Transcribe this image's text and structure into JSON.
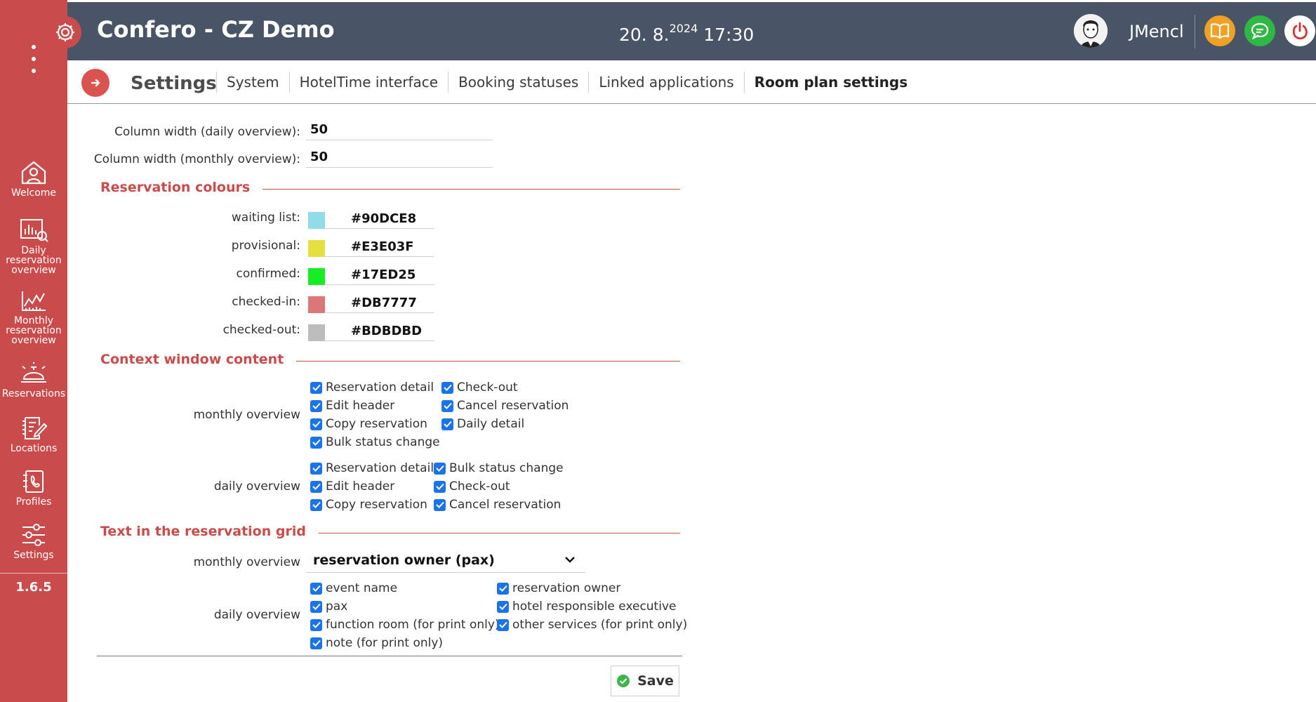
{
  "topbar": {
    "title": "Confero - CZ Demo",
    "date": "20. 8.",
    "year": "2024",
    "time": "17:30",
    "username": "JMencl"
  },
  "sidebar": {
    "items": [
      {
        "label": "Welcome",
        "icon": "house-user-icon"
      },
      {
        "label": "Daily reservation overview",
        "icon": "daily-chart-search-icon"
      },
      {
        "label": "Monthly reservation overview",
        "icon": "monthly-line-chart-icon"
      },
      {
        "label": "Reservations",
        "icon": "service-bell-icon"
      },
      {
        "label": "Locations",
        "icon": "edit-document-icon"
      },
      {
        "label": "Profiles",
        "icon": "address-book-icon"
      },
      {
        "label": "Settings",
        "icon": "sliders-icon"
      }
    ],
    "version": "1.6.5"
  },
  "tabs": {
    "title": "Settings",
    "items": [
      "System",
      "HotelTime interface",
      "Booking statuses",
      "Linked applications",
      "Room plan settings"
    ],
    "active": "Room plan settings"
  },
  "columns": {
    "daily_label": "Column width (daily overview):",
    "daily_value": "50",
    "monthly_label": "Column width (monthly overview):",
    "monthly_value": "50"
  },
  "colours": {
    "heading": "Reservation colours",
    "items": [
      {
        "label": "waiting list:",
        "hex": "#90DCE8",
        "color": "#90DCE8"
      },
      {
        "label": "provisional:",
        "hex": "#E3E03F",
        "color": "#E3E03F"
      },
      {
        "label": "confirmed:",
        "hex": "#17ED25",
        "color": "#17ED25"
      },
      {
        "label": "checked-in:",
        "hex": "#DB7777",
        "color": "#DB7777"
      },
      {
        "label": "checked-out:",
        "hex": "#BDBDBD",
        "color": "#BDBDBD"
      }
    ]
  },
  "context": {
    "heading": "Context window content",
    "monthly_label": "monthly overview",
    "monthly": [
      "Reservation detail",
      "Check-out",
      "Edit header",
      "Cancel reservation",
      "Copy reservation",
      "Daily detail",
      "Bulk status change"
    ],
    "daily_label": "daily overview",
    "daily": [
      "Reservation detail",
      "Bulk status change",
      "Edit header",
      "Check-out",
      "Copy reservation",
      "Cancel reservation"
    ]
  },
  "grid_text": {
    "heading": "Text in the reservation grid",
    "monthly_label": "monthly overview",
    "monthly_selected": "reservation owner (pax)",
    "daily_label": "daily overview",
    "daily": [
      "event name",
      "reservation owner",
      "pax",
      "hotel responsible executive",
      "function room (for print only)",
      "other services (for print only)",
      "note (for print only)"
    ]
  },
  "save_label": "Save",
  "colors_theme": {
    "sidebar": "#c94b4b",
    "topbar": "#495567",
    "accent": "#c94b4b",
    "checkbox": "#1a73e8"
  }
}
